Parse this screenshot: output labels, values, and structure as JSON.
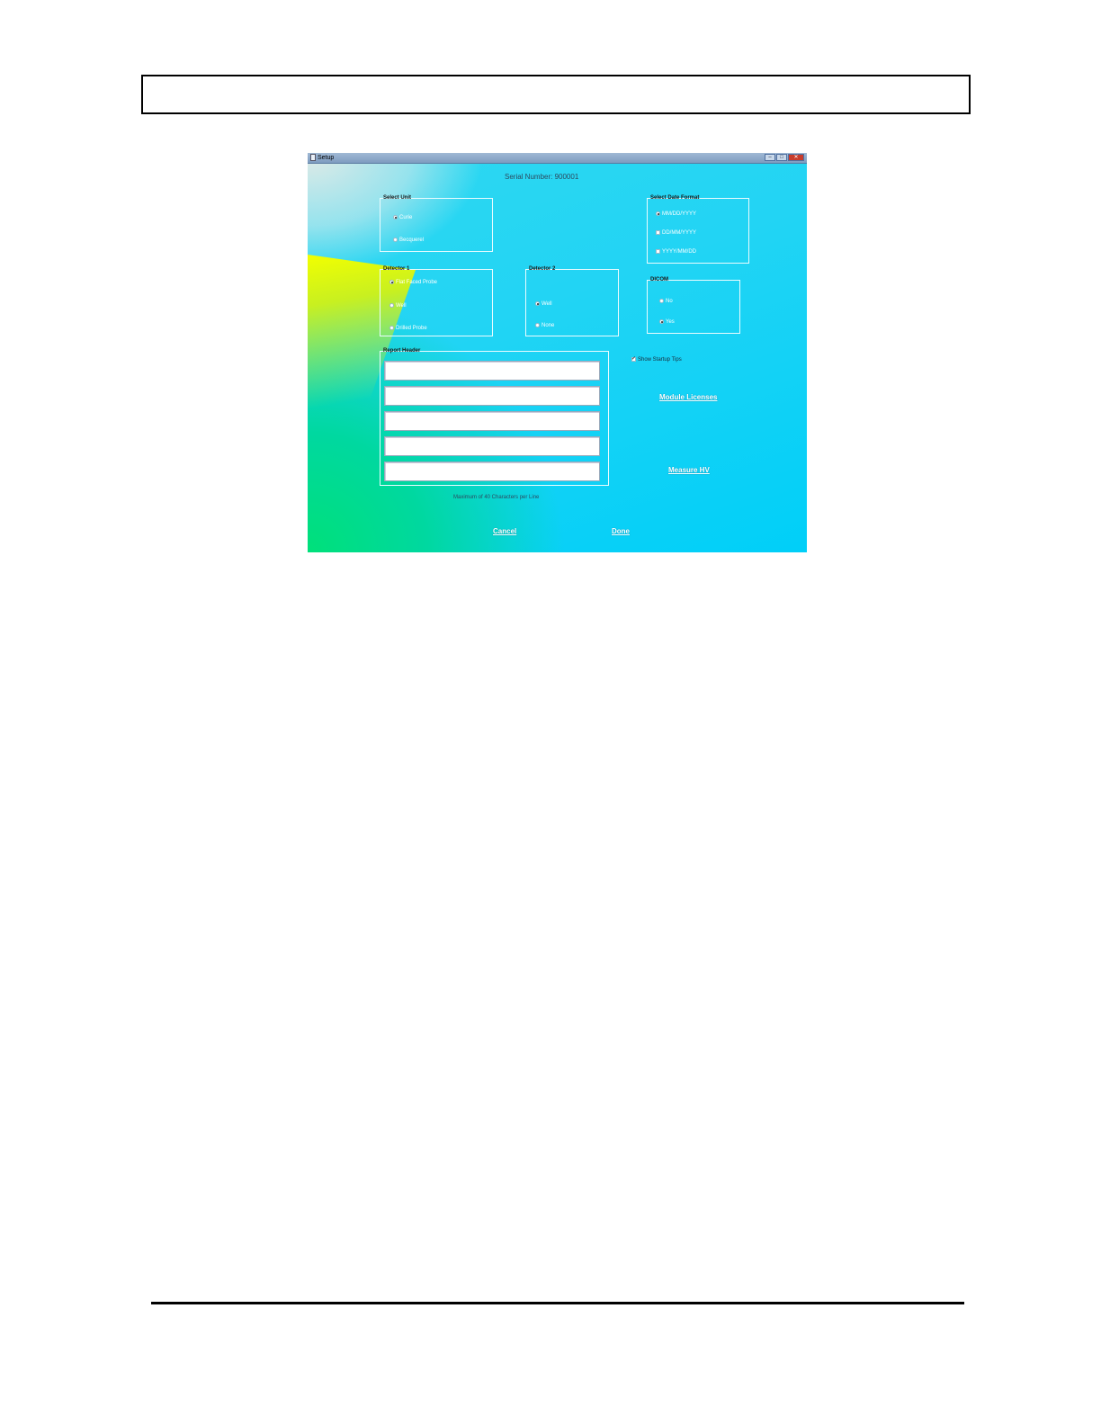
{
  "window": {
    "title": "Setup",
    "min": "–",
    "max": "□",
    "close": "✕"
  },
  "serial_number": "Serial Number: 900001",
  "select_unit": {
    "title": "Select Unit",
    "options": [
      {
        "label": "Curie",
        "selected": true
      },
      {
        "label": "Becquerel",
        "selected": false
      }
    ]
  },
  "date_format": {
    "title": "Select Date Format",
    "options": [
      {
        "label": "MM/DD/YYYY",
        "selected": true
      },
      {
        "label": "DD/MM/YYYY",
        "selected": false
      },
      {
        "label": "YYYY/MM/DD",
        "selected": false
      }
    ]
  },
  "detector1": {
    "title": "Detector 1",
    "options": [
      {
        "label": "Flat Faced Probe",
        "selected": true
      },
      {
        "label": "Well",
        "selected": false
      },
      {
        "label": "Drilled Probe",
        "selected": false
      }
    ]
  },
  "detector2": {
    "title": "Detector 2",
    "options": [
      {
        "label": "Well",
        "selected": true
      },
      {
        "label": "None",
        "selected": false
      }
    ]
  },
  "dicom": {
    "title": "DICOM",
    "options": [
      {
        "label": "No",
        "selected": false
      },
      {
        "label": "Yes",
        "selected": true
      }
    ]
  },
  "report_header": {
    "title": "Report Header",
    "lines": [
      "",
      "",
      "",
      "",
      ""
    ],
    "hint": "Maximum of 40 Characters per Line"
  },
  "show_startup_tips": {
    "label": "Show Startup Tips",
    "checked": true
  },
  "buttons": {
    "module_licenses": "Module Licenses",
    "measure_hv": "Measure HV",
    "cancel": "Cancel",
    "done": "Done"
  }
}
